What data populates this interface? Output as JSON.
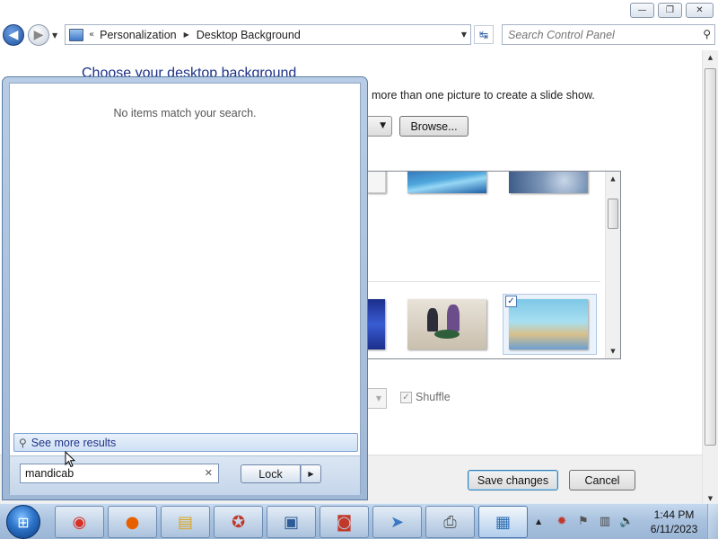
{
  "window": {
    "min_glyph": "—",
    "max_glyph": "❐",
    "close_glyph": "✕"
  },
  "nav": {
    "back_glyph": "◀",
    "forward_glyph": "▶",
    "recent_glyph": "▼",
    "chevron": "«",
    "breadcrumb": [
      "Personalization",
      "Desktop Background"
    ],
    "crumb_sep": "▶",
    "dropdown_glyph": "▼",
    "refresh_glyph": "↹",
    "search_placeholder": "Search Control Panel",
    "search_glyph": "⚲"
  },
  "content": {
    "heading": "Choose your desktop background",
    "instruction": "more than one picture to create a slide show.",
    "location_arrow": "▼",
    "browse_label": "Browse...",
    "selected_check": "✓",
    "scroll_up": "▲",
    "scroll_down": "▼",
    "time_arrow": "▼",
    "shuffle_check": "✓",
    "shuffle_label": "Shuffle",
    "shuffle_checked": true,
    "save_label": "Save changes",
    "cancel_label": "Cancel"
  },
  "startmenu": {
    "no_items": "No items match your search.",
    "see_more": "See more results",
    "search_glyph": "⚲",
    "search_value": "mandicab",
    "clear_glyph": "✕",
    "lock_label": "Lock",
    "lock_arrow": "▶"
  },
  "taskbar": {
    "start_glyph": "⊞",
    "apps": [
      {
        "name": "chrome",
        "glyph": "◉",
        "color": "#d93025"
      },
      {
        "name": "firefox",
        "glyph": "●",
        "color": "#e66000"
      },
      {
        "name": "explorer",
        "glyph": "▤",
        "color": "#d9a520"
      },
      {
        "name": "red-app",
        "glyph": "✪",
        "color": "#c0392b"
      },
      {
        "name": "screen-app",
        "glyph": "▣",
        "color": "#2d5b96"
      },
      {
        "name": "recorder",
        "glyph": "◙",
        "color": "#c0392b"
      },
      {
        "name": "mail-plane",
        "glyph": "➤",
        "color": "#3a78c2"
      },
      {
        "name": "fax",
        "glyph": "⎙",
        "color": "#555555"
      },
      {
        "name": "control-panel",
        "glyph": "▦",
        "color": "#2d6fb5"
      }
    ],
    "tray_arrow": "▲",
    "tray_icons": [
      {
        "name": "security-icon",
        "glyph": "✹",
        "color": "#c0392b"
      },
      {
        "name": "flag-icon",
        "glyph": "⚑",
        "color": "#555555"
      },
      {
        "name": "network-icon",
        "glyph": "▥",
        "color": "#444444"
      },
      {
        "name": "volume-icon",
        "glyph": "🔈",
        "color": "#444444"
      }
    ],
    "time": "1:44 PM",
    "date": "6/11/2023"
  }
}
